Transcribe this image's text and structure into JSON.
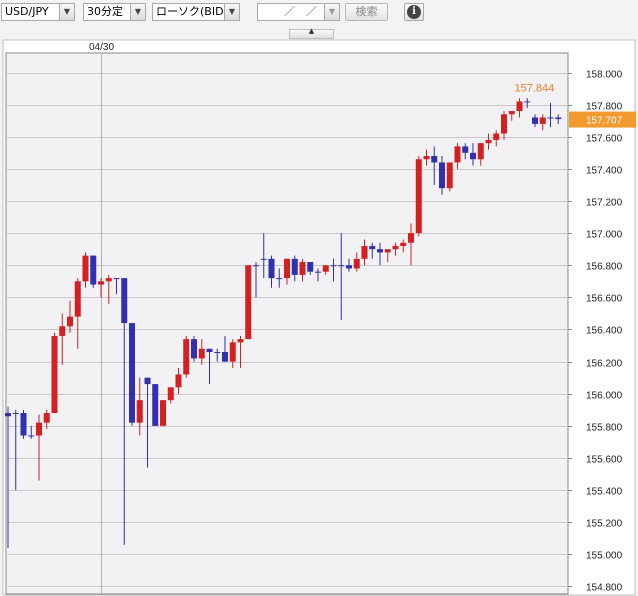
{
  "toolbar": {
    "pair": "USD/JPY",
    "interval": "30分定",
    "chart_style": "ローソク(BID)",
    "date": "／　／",
    "search_label": "検索",
    "info_glyph": "i",
    "arrow_glyph": "▼",
    "collapse_glyph": "▲"
  },
  "colors": {
    "up": "#d42020",
    "down": "#3030b0",
    "flat": "#3030b0",
    "price_tag": "#f39a2e",
    "high_label": "#f08020",
    "grid": "#c8c8c8"
  },
  "chart_data": {
    "type": "candlestick",
    "date_label": "04/30",
    "date_label_index": 12,
    "ylim": [
      154.8,
      158.1
    ],
    "y_ticks": [
      "158.000",
      "157.800",
      "157.600",
      "157.400",
      "157.200",
      "157.000",
      "156.800",
      "156.600",
      "156.400",
      "156.200",
      "156.000",
      "155.800",
      "155.600",
      "155.400",
      "155.200",
      "155.000",
      "154.800"
    ],
    "current_price": "157.707",
    "high_marker": {
      "label": "157.844",
      "index": 71
    },
    "candles": [
      [
        155.88,
        155.92,
        155.04,
        155.86
      ],
      [
        155.88,
        155.9,
        155.4,
        155.88
      ],
      [
        155.88,
        155.9,
        155.72,
        155.74
      ],
      [
        155.74,
        155.8,
        155.72,
        155.74
      ],
      [
        155.74,
        155.87,
        155.46,
        155.82
      ],
      [
        155.82,
        155.9,
        155.78,
        155.88
      ],
      [
        155.88,
        156.38,
        155.88,
        156.36
      ],
      [
        156.36,
        156.5,
        156.18,
        156.42
      ],
      [
        156.42,
        156.58,
        156.38,
        156.48
      ],
      [
        156.48,
        156.72,
        156.28,
        156.7
      ],
      [
        156.7,
        156.88,
        156.66,
        156.86
      ],
      [
        156.86,
        156.86,
        156.66,
        156.68
      ],
      [
        156.68,
        156.72,
        156.6,
        156.7
      ],
      [
        156.7,
        156.74,
        156.56,
        156.72
      ],
      [
        156.72,
        156.72,
        156.62,
        156.72
      ],
      [
        156.72,
        156.72,
        155.06,
        156.44
      ],
      [
        156.44,
        156.44,
        155.8,
        155.82
      ],
      [
        155.82,
        156.1,
        155.74,
        155.96
      ],
      [
        156.1,
        156.1,
        155.54,
        156.06
      ],
      [
        156.06,
        156.06,
        155.8,
        155.8
      ],
      [
        155.8,
        155.96,
        155.8,
        155.96
      ],
      [
        155.96,
        156.04,
        155.94,
        156.04
      ],
      [
        156.04,
        156.16,
        156.0,
        156.12
      ],
      [
        156.12,
        156.36,
        156.1,
        156.34
      ],
      [
        156.34,
        156.36,
        156.2,
        156.22
      ],
      [
        156.22,
        156.34,
        156.18,
        156.28
      ],
      [
        156.28,
        156.28,
        156.06,
        156.26
      ],
      [
        156.26,
        156.28,
        156.2,
        156.26
      ],
      [
        156.26,
        156.36,
        156.2,
        156.2
      ],
      [
        156.2,
        156.34,
        156.16,
        156.32
      ],
      [
        156.32,
        156.36,
        156.16,
        156.34
      ],
      [
        156.34,
        156.8,
        156.34,
        156.8
      ],
      [
        156.8,
        156.82,
        156.6,
        156.8
      ],
      [
        156.84,
        157.0,
        156.72,
        156.84
      ],
      [
        156.84,
        156.86,
        156.66,
        156.72
      ],
      [
        156.72,
        156.78,
        156.66,
        156.72
      ],
      [
        156.72,
        156.84,
        156.68,
        156.84
      ],
      [
        156.84,
        156.86,
        156.7,
        156.74
      ],
      [
        156.74,
        156.84,
        156.7,
        156.82
      ],
      [
        156.82,
        156.82,
        156.74,
        156.76
      ],
      [
        156.76,
        156.78,
        156.7,
        156.76
      ],
      [
        156.76,
        156.8,
        156.74,
        156.8
      ],
      [
        156.8,
        156.84,
        156.7,
        156.8
      ],
      [
        156.8,
        157.0,
        156.46,
        156.8
      ],
      [
        156.8,
        156.84,
        156.76,
        156.78
      ],
      [
        156.78,
        156.88,
        156.76,
        156.84
      ],
      [
        156.84,
        156.96,
        156.8,
        156.92
      ],
      [
        156.92,
        156.94,
        156.84,
        156.9
      ],
      [
        156.9,
        156.94,
        156.8,
        156.88
      ],
      [
        156.88,
        156.9,
        156.82,
        156.9
      ],
      [
        156.9,
        156.94,
        156.86,
        156.92
      ],
      [
        156.92,
        156.96,
        156.88,
        156.94
      ],
      [
        156.94,
        157.06,
        156.8,
        157.0
      ],
      [
        157.0,
        157.48,
        156.98,
        157.46
      ],
      [
        157.46,
        157.52,
        157.42,
        157.48
      ],
      [
        157.48,
        157.54,
        157.3,
        157.44
      ],
      [
        157.44,
        157.48,
        157.24,
        157.28
      ],
      [
        157.28,
        157.44,
        157.26,
        157.44
      ],
      [
        157.44,
        157.56,
        157.4,
        157.54
      ],
      [
        157.54,
        157.56,
        157.46,
        157.5
      ],
      [
        157.5,
        157.56,
        157.42,
        157.46
      ],
      [
        157.46,
        157.56,
        157.42,
        157.56
      ],
      [
        157.56,
        157.62,
        157.52,
        157.58
      ],
      [
        157.58,
        157.64,
        157.54,
        157.62
      ],
      [
        157.62,
        157.76,
        157.58,
        157.74
      ],
      [
        157.74,
        157.76,
        157.7,
        157.76
      ],
      [
        157.76,
        157.84,
        157.72,
        157.82
      ],
      [
        157.82,
        157.84,
        157.78,
        157.82
      ],
      [
        157.72,
        157.74,
        157.66,
        157.68
      ],
      [
        157.68,
        157.74,
        157.64,
        157.72
      ],
      [
        157.72,
        157.81,
        157.66,
        157.72
      ],
      [
        157.72,
        157.74,
        157.68,
        157.71
      ]
    ]
  }
}
